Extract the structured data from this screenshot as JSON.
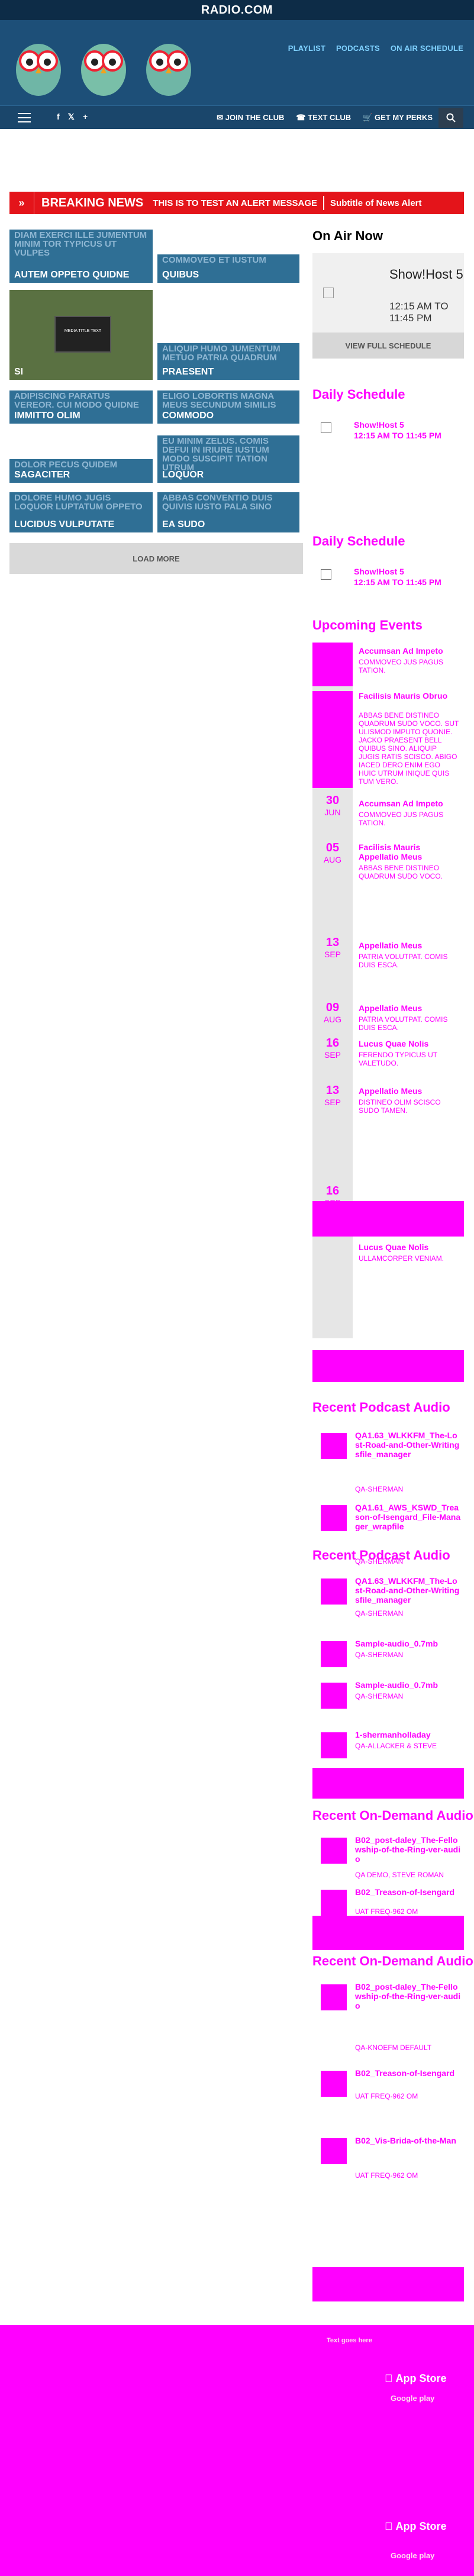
{
  "brand": {
    "logo": "RADIO.COM"
  },
  "nav": {
    "items": [
      "PLAYLIST",
      "PODCASTS",
      "ON AIR SCHEDULE"
    ]
  },
  "subnav": {
    "social": [
      "f",
      "t",
      "+"
    ],
    "join": "JOIN THE CLUB",
    "text": "TEXT CLUB",
    "perks": "GET MY PERKS"
  },
  "breaking": {
    "label": "BREAKING NEWS",
    "message": "THIS IS TO TEST AN ALERT MESSAGE",
    "subtitle": "Subtitle of News Alert"
  },
  "tiles": [
    {
      "top": "DIAM EXERCI ILLE JUMENTUM MINIM TOR TYPICUS UT VULPES",
      "bottom": "AUTEM OPPETO QUIDNE"
    },
    {
      "top": "COMMOVEO ET IUSTUM",
      "bottom": "QUIBUS"
    },
    {
      "top": "",
      "bottom": "SI",
      "tv": "MEDIA TITLE TEXT"
    },
    {
      "top": "ALIQUIP HUMO JUMENTUM METUO PATRIA QUADRUM",
      "bottom": "PRAESENT"
    },
    {
      "top": "ADIPISCING PARATUS VEREOR. CUI MODO QUIDNE",
      "bottom": "IMMITTO OLIM"
    },
    {
      "top": "ELIGO LOBORTIS MAGNA MEUS SECUNDUM SIMILIS",
      "bottom": "COMMODO"
    },
    {
      "top": "DOLOR PECUS QUIDEM",
      "bottom": "SAGACITER"
    },
    {
      "top": "EU MINIM ZELUS. COMIS DEFUI IN IRIURE IUSTUM MODO SUSCIPIT TATION UTRUM",
      "bottom": "LOQUOR"
    },
    {
      "top": "DOLORE HUMO JUGIS LOQUOR LUPTATUM OPPETO",
      "bottom": "LUCIDUS VULPUTATE"
    },
    {
      "top": "ABBAS CONVENTIO DUIS QUIVIS IUSTO PALA SINO",
      "bottom": "EA SUDO"
    }
  ],
  "loadmore": "LOAD MORE",
  "onair": {
    "heading": "On Air Now",
    "show": "Show!Host 5",
    "time": "12:15 AM TO 11:45 PM",
    "view": "VIEW FULL SCHEDULE"
  },
  "daily": {
    "heading": "Daily Schedule",
    "show": "Show!Host 5",
    "time": "12:15 AM TO 11:45 PM"
  },
  "daily2": {
    "heading": "Daily Schedule",
    "show": "Show!Host 5",
    "time": "12:15 AM TO 11:45 PM"
  },
  "events": {
    "heading": "Upcoming Events",
    "items": [
      {
        "day": "",
        "mon": "",
        "title": "Accumsan Ad Impeto",
        "desc": "COMMOVEO JUS PAGUS TATION."
      },
      {
        "day": "",
        "mon": "",
        "title": "Facilisis Mauris Obruo",
        "desc": "ABBAS BENE DISTINEO QUADRUM SUDO VOCO. SUT ULISMOD IMPUTO QUONIE. JACKO PRAESENT BELL QUIBUS SINO. ALIQUIP JUGIS RATIS SCISCO. ABIGO IACED DERO ENIM EGO HUIC UTRUM INIQUE QUIS TUM VERO."
      },
      {
        "day": "30",
        "mon": "JUN",
        "title": "Accumsan Ad Impeto",
        "desc": "COMMOVEO JUS PAGUS TATION."
      },
      {
        "day": "05",
        "mon": "AUG",
        "title": "Facilisis Mauris Appellatio Meus",
        "desc": "ABBAS BENE DISTINEO QUADRUM SUDO VOCO."
      },
      {
        "day": "13",
        "mon": "SEP",
        "title": "Appellatio Meus",
        "desc": "PATRIA VOLUTPAT. COMIS DUIS ESCA."
      },
      {
        "day": "09",
        "mon": "AUG",
        "title": "Appellatio Meus",
        "desc": "PATRIA VOLUTPAT. COMIS DUIS ESCA."
      },
      {
        "day": "16",
        "mon": "SEP",
        "title": "Lucus Quae Nolis",
        "desc": "FERENDO TYPICUS UT VALETUDO."
      },
      {
        "day": "13",
        "mon": "SEP",
        "title": "Appellatio Meus",
        "desc": "DISTINEO OLIM SCISCO SUDO TAMEN."
      },
      {
        "day": "16",
        "mon": "SEP",
        "title": "Lucus Quae Nolis",
        "desc": "ULLAMCORPER VENIAM."
      }
    ]
  },
  "podcasts": {
    "heading": "Recent Podcast Audio",
    "items": [
      {
        "title": "QA1.63_WLKKFM_The-Lost-Road-and-Other-Writingsfile_manager",
        "author": "QA-SHERMAN"
      },
      {
        "title": "QA1.61_AWS_KSWD_Treason-of-Isengard_File-Manager_wrapfile",
        "author": "QA-SHERMAN"
      },
      {
        "title": "Sample-audio_0.7mb",
        "author": "QA-SHERMAN"
      },
      {
        "title": "1-shermanholladay",
        "author": "QA-ALLACKER & STEVE"
      }
    ]
  },
  "podcasts2": {
    "heading": "Recent Podcast Audio",
    "items": [
      {
        "title": "QA1.63_WLKKFM_The-Lost-Road-and-Other-Writingsfile_manager",
        "author": "QA-SHERMAN"
      },
      {
        "title": "Sample-audio_0.7mb",
        "author": "QA-SHERMAN"
      }
    ]
  },
  "ondemand": {
    "heading": "Recent On-Demand Audio",
    "items": [
      {
        "title": "B02_post-daley_The-Fellowship-of-the-Ring-ver-audio",
        "author": "QA DEMO, STEVE ROMAN"
      },
      {
        "title": "B02_Treason-of-Isengard",
        "author": "UAT FREQ-962 OM"
      }
    ]
  },
  "ondemand2": {
    "heading": "Recent On-Demand Audio",
    "items": [
      {
        "title": "B02_post-daley_The-Fellowship-of-the-Ring-ver-audio",
        "author": "QA-KNOEFM DEFAULT"
      },
      {
        "title": "B02_Treason-of-Isengard",
        "author": "UAT FREQ-962 OM"
      },
      {
        "title": "B02_Vis-Brida-of-the-Man",
        "author": "UAT FREQ-962 OM"
      }
    ]
  },
  "footer": {
    "app": "App Store",
    "google": "Google play",
    "text": "Text goes here"
  }
}
